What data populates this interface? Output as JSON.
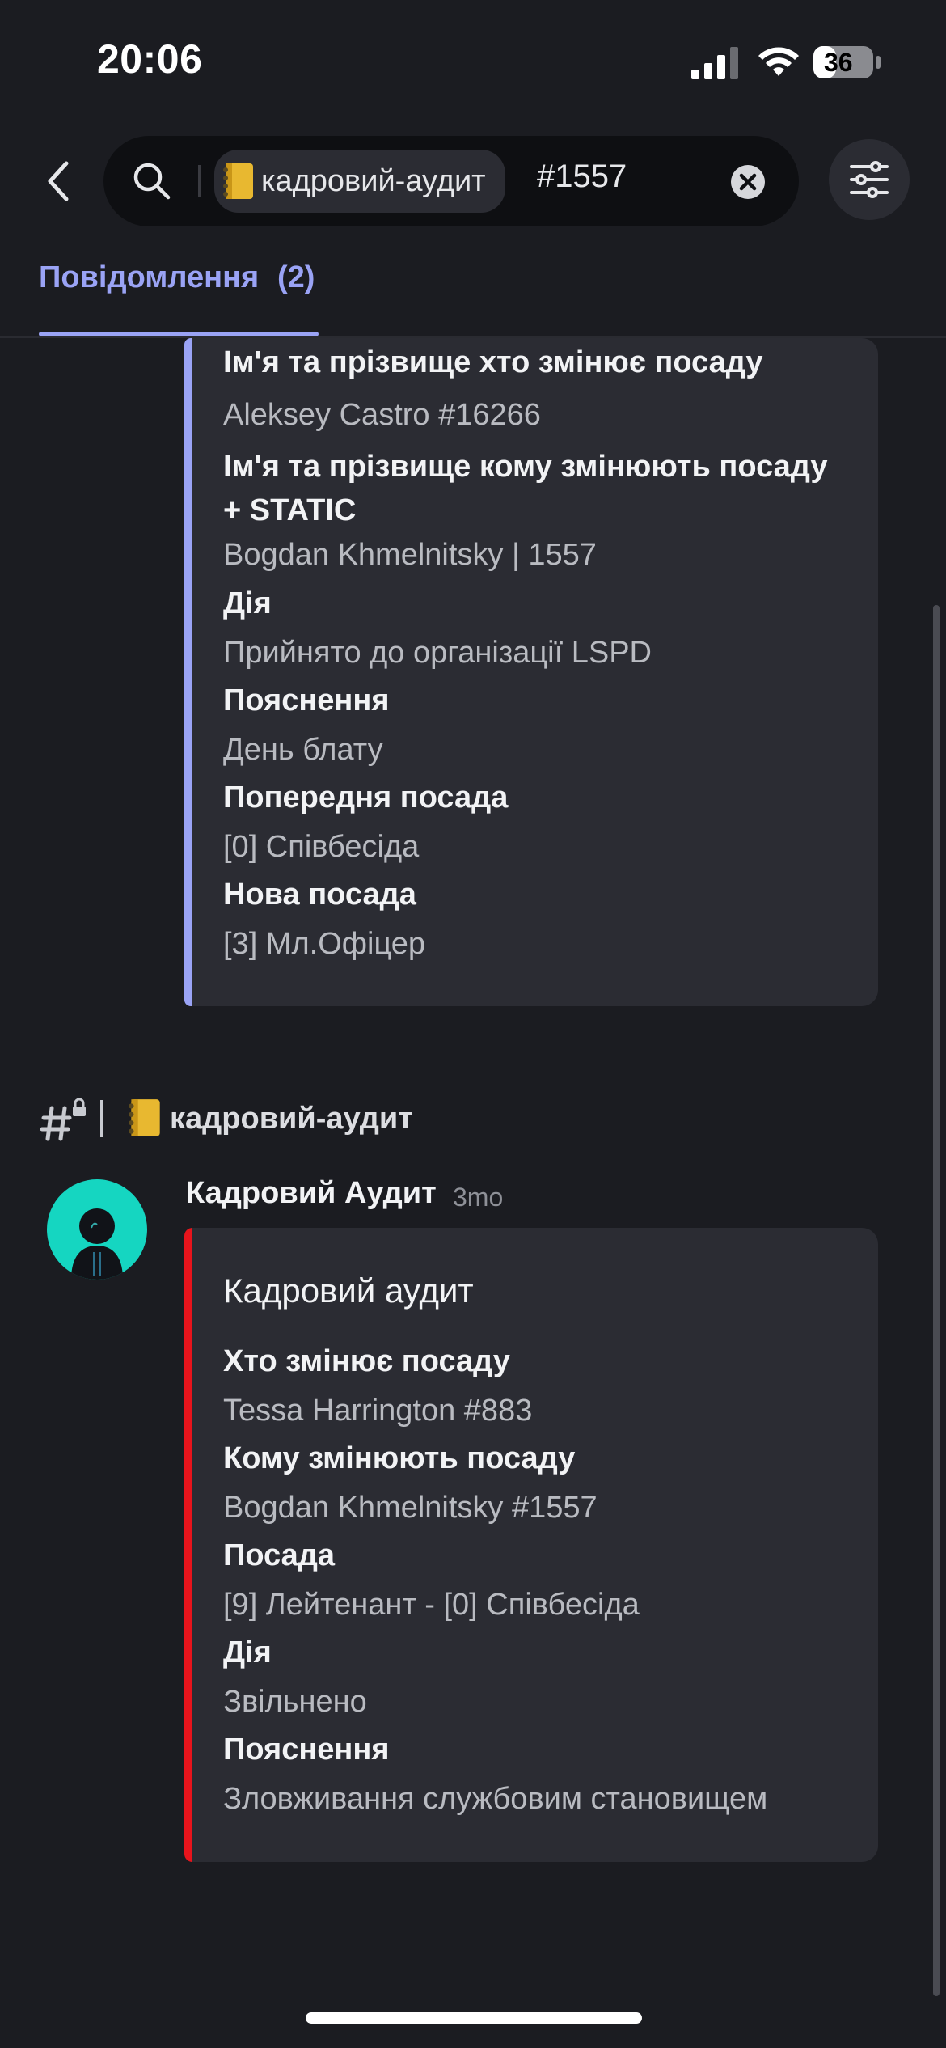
{
  "status_bar": {
    "time": "20:06",
    "battery": "36"
  },
  "search": {
    "channel_chip": "кадровий-аудит",
    "query": "#1557"
  },
  "tab": {
    "label": "Повідомлення",
    "count": "(2)"
  },
  "first_result": {
    "fields": [
      {
        "name": "Ім'я та прізвище хто змінює посаду",
        "value": "Aleksey Castro #16266"
      },
      {
        "name": "Ім'я та прізвище кому змінюють посаду + STATIC",
        "value": "Bogdan Khmelnitsky | 1557"
      },
      {
        "name": "Дія",
        "value": "Прийнято до організації LSPD"
      },
      {
        "name": "Пояснення",
        "value": "День блату"
      },
      {
        "name": "Попередня посада",
        "value": "[0] Співбесіда"
      },
      {
        "name": "Нова посада",
        "value": "[3] Мл.Офіцер"
      }
    ],
    "accent_color": "#9aa3f5"
  },
  "second_result": {
    "channel": {
      "hash": "#",
      "name": "кадровий-аудит"
    },
    "author": "Кадровий Аудит",
    "timestamp": "3mo",
    "embed": {
      "title": "Кадровий аудит",
      "accent_color": "#e8141c",
      "fields": [
        {
          "name": "Хто змінює посаду",
          "value": "Tessa Harrington #883"
        },
        {
          "name": "Кому змінюють посаду",
          "value": "Bogdan Khmelnitsky #1557"
        },
        {
          "name": "Посада",
          "value": "[9] Лейтенант - [0] Співбесіда"
        },
        {
          "name": "Дія",
          "value": "Звільнено"
        },
        {
          "name": "Пояснення",
          "value": "Зловживання службовим становищем"
        }
      ]
    }
  },
  "icons": {
    "back": "chevron-left-icon",
    "search": "search-icon",
    "clear": "clear-x-icon",
    "filter": "sliders-icon",
    "notebook": "notebook-emoji-icon",
    "channel_type": "locked-channel-hash-icon"
  }
}
